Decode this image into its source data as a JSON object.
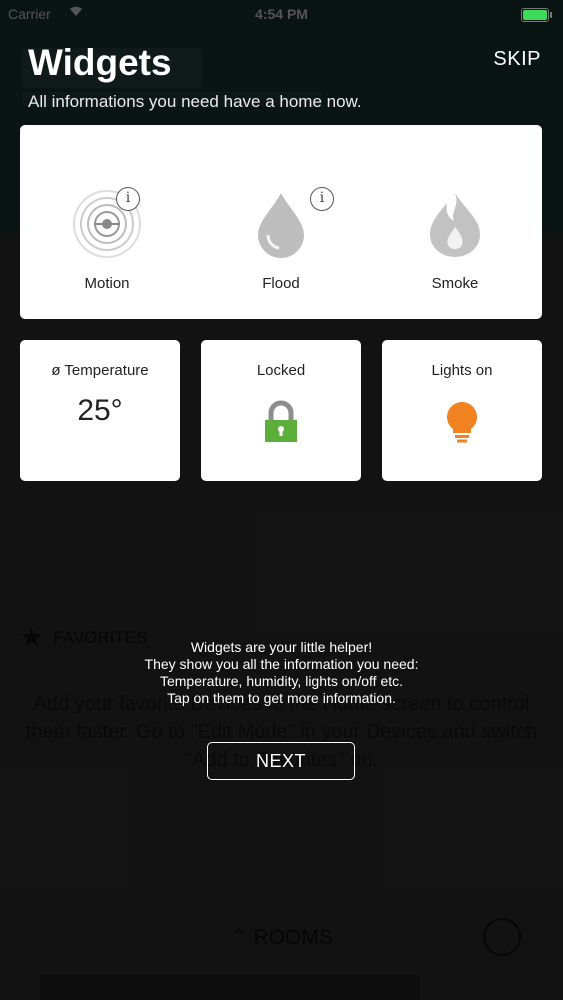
{
  "status_bar": {
    "carrier": "Carrier",
    "time": "4:54 PM",
    "battery_percent": 100
  },
  "header": {
    "title": "Widgets",
    "subtitle": "All informations you need have a home now.",
    "skip_label": "SKIP"
  },
  "sensors": [
    {
      "label": "Motion",
      "icon": "motion-icon"
    },
    {
      "label": "Flood",
      "icon": "water-drop-icon"
    },
    {
      "label": "Smoke",
      "icon": "flame-icon"
    }
  ],
  "tiles": {
    "temperature": {
      "label": "ø Temperature",
      "value": "25°"
    },
    "lock": {
      "label": "Locked",
      "icon": "padlock-icon",
      "color": "#5cae3b"
    },
    "lights": {
      "label": "Lights on",
      "icon": "light-bulb-icon",
      "color": "#f0821f"
    }
  },
  "tooltip": {
    "lines": [
      "Widgets are your little helper!",
      "They show you all the information you need:",
      "Temperature, humidity, lights on/off etc.",
      "Tap on them to get more information."
    ],
    "next_label": "NEXT"
  },
  "background": {
    "favorites_label": "FAVORITES",
    "favorites_hint": "Add your favorite Devices to the Home screen to control them faster. Go to \"Edit Mode\" in your Devices and switch \"Add to Favorites\" on.",
    "rooms_label": "ROOMS"
  }
}
